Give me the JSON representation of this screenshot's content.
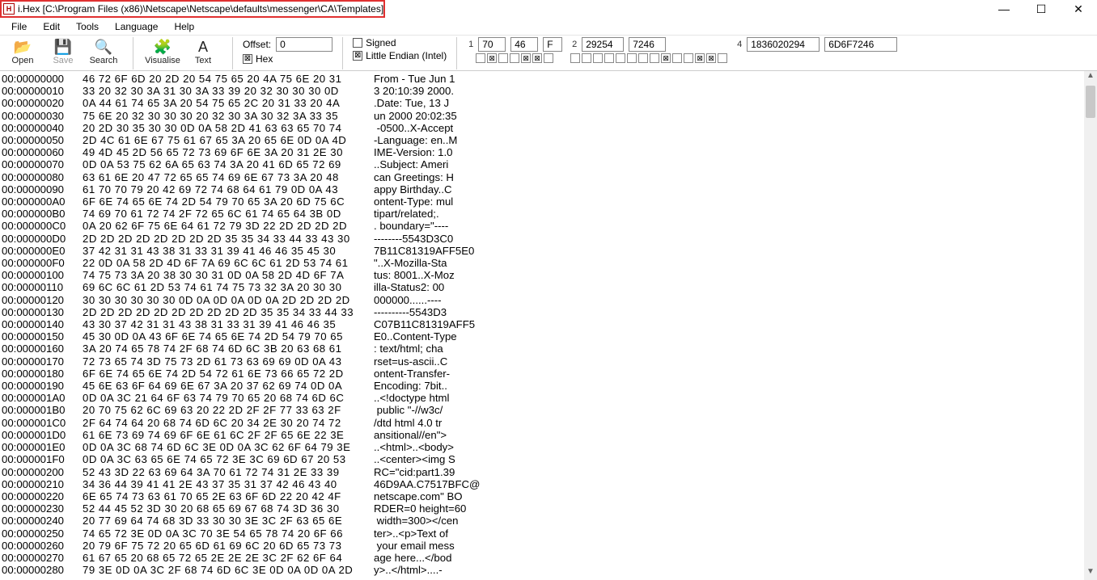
{
  "window": {
    "title": "i.Hex [C:\\Program Files (x86)\\Netscape\\Netscape\\defaults\\messenger\\CA\\Templates]"
  },
  "menu": {
    "items": [
      "File",
      "Edit",
      "Tools",
      "Language",
      "Help"
    ]
  },
  "toolbar": {
    "open": "Open",
    "save": "Save",
    "search": "Search",
    "visualise": "Visualise",
    "text": "Text"
  },
  "offset": {
    "label": "Offset:",
    "value": "0",
    "hex_label": "Hex",
    "hex_checked": true
  },
  "flags": {
    "signed": "Signed",
    "signed_checked": false,
    "endian": "Little Endian (Intel)",
    "endian_checked": true
  },
  "values": {
    "g1": {
      "idx": "1",
      "a": "70",
      "b": "46",
      "c": "F",
      "boxes": [
        "",
        "⊠",
        "",
        "",
        "⊠",
        "⊠",
        ""
      ]
    },
    "g2": {
      "idx": "2",
      "a": "29254",
      "b": "7246",
      "boxes": [
        "",
        "",
        "",
        "",
        "",
        "",
        "",
        "",
        "⊠",
        "",
        "",
        "⊠",
        "⊠",
        ""
      ]
    },
    "g4": {
      "idx": "4",
      "a": "1836020294",
      "b": "6D6F7246"
    }
  },
  "hex": {
    "lines": [
      {
        "addr": "00:00000000",
        "bytes": "46 72 6F 6D 20 2D 20 54 75 65 20 4A 75 6E 20 31",
        "ascii": "From - Tue Jun 1"
      },
      {
        "addr": "00:00000010",
        "bytes": "33 20 32 30 3A 31 30 3A 33 39 20 32 30 30 30 0D",
        "ascii": "3 20:10:39 2000."
      },
      {
        "addr": "00:00000020",
        "bytes": "0A 44 61 74 65 3A 20 54 75 65 2C 20 31 33 20 4A",
        "ascii": ".Date: Tue, 13 J"
      },
      {
        "addr": "00:00000030",
        "bytes": "75 6E 20 32 30 30 30 20 32 30 3A 30 32 3A 33 35",
        "ascii": "un 2000 20:02:35"
      },
      {
        "addr": "00:00000040",
        "bytes": "20 2D 30 35 30 30 0D 0A 58 2D 41 63 63 65 70 74",
        "ascii": " -0500..X-Accept"
      },
      {
        "addr": "00:00000050",
        "bytes": "2D 4C 61 6E 67 75 61 67 65 3A 20 65 6E 0D 0A 4D",
        "ascii": "-Language: en..M"
      },
      {
        "addr": "00:00000060",
        "bytes": "49 4D 45 2D 56 65 72 73 69 6F 6E 3A 20 31 2E 30",
        "ascii": "IME-Version: 1.0"
      },
      {
        "addr": "00:00000070",
        "bytes": "0D 0A 53 75 62 6A 65 63 74 3A 20 41 6D 65 72 69",
        "ascii": "..Subject: Ameri"
      },
      {
        "addr": "00:00000080",
        "bytes": "63 61 6E 20 47 72 65 65 74 69 6E 67 73 3A 20 48",
        "ascii": "can Greetings: H"
      },
      {
        "addr": "00:00000090",
        "bytes": "61 70 70 79 20 42 69 72 74 68 64 61 79 0D 0A 43",
        "ascii": "appy Birthday..C"
      },
      {
        "addr": "00:000000A0",
        "bytes": "6F 6E 74 65 6E 74 2D 54 79 70 65 3A 20 6D 75 6C",
        "ascii": "ontent-Type: mul"
      },
      {
        "addr": "00:000000B0",
        "bytes": "74 69 70 61 72 74 2F 72 65 6C 61 74 65 64 3B 0D",
        "ascii": "tipart/related;."
      },
      {
        "addr": "00:000000C0",
        "bytes": "0A 20 62 6F 75 6E 64 61 72 79 3D 22 2D 2D 2D 2D",
        "ascii": ". boundary=\"----"
      },
      {
        "addr": "00:000000D0",
        "bytes": "2D 2D 2D 2D 2D 2D 2D 2D 35 35 34 33 44 33 43 30",
        "ascii": "--------5543D3C0"
      },
      {
        "addr": "00:000000E0",
        "bytes": "37 42 31 31 43 38 31 33 31 39 41 46 46 35 45 30",
        "ascii": "7B11C81319AFF5E0"
      },
      {
        "addr": "00:000000F0",
        "bytes": "22 0D 0A 58 2D 4D 6F 7A 69 6C 6C 61 2D 53 74 61",
        "ascii": "\"..X-Mozilla-Sta"
      },
      {
        "addr": "00:00000100",
        "bytes": "74 75 73 3A 20 38 30 30 31 0D 0A 58 2D 4D 6F 7A",
        "ascii": "tus: 8001..X-Moz"
      },
      {
        "addr": "00:00000110",
        "bytes": "69 6C 6C 61 2D 53 74 61 74 75 73 32 3A 20 30 30",
        "ascii": "illa-Status2: 00"
      },
      {
        "addr": "00:00000120",
        "bytes": "30 30 30 30 30 30 0D 0A 0D 0A 0D 0A 2D 2D 2D 2D",
        "ascii": "000000......----"
      },
      {
        "addr": "00:00000130",
        "bytes": "2D 2D 2D 2D 2D 2D 2D 2D 2D 2D 35 35 34 33 44 33",
        "ascii": "----------5543D3"
      },
      {
        "addr": "00:00000140",
        "bytes": "43 30 37 42 31 31 43 38 31 33 31 39 41 46 46 35",
        "ascii": "C07B11C81319AFF5"
      },
      {
        "addr": "00:00000150",
        "bytes": "45 30 0D 0A 43 6F 6E 74 65 6E 74 2D 54 79 70 65",
        "ascii": "E0..Content-Type"
      },
      {
        "addr": "00:00000160",
        "bytes": "3A 20 74 65 78 74 2F 68 74 6D 6C 3B 20 63 68 61",
        "ascii": ": text/html; cha"
      },
      {
        "addr": "00:00000170",
        "bytes": "72 73 65 74 3D 75 73 2D 61 73 63 69 69 0D 0A 43",
        "ascii": "rset=us-ascii..C"
      },
      {
        "addr": "00:00000180",
        "bytes": "6F 6E 74 65 6E 74 2D 54 72 61 6E 73 66 65 72 2D",
        "ascii": "ontent-Transfer-"
      },
      {
        "addr": "00:00000190",
        "bytes": "45 6E 63 6F 64 69 6E 67 3A 20 37 62 69 74 0D 0A",
        "ascii": "Encoding: 7bit.."
      },
      {
        "addr": "00:000001A0",
        "bytes": "0D 0A 3C 21 64 6F 63 74 79 70 65 20 68 74 6D 6C",
        "ascii": "..<!doctype html"
      },
      {
        "addr": "00:000001B0",
        "bytes": "20 70 75 62 6C 69 63 20 22 2D 2F 2F 77 33 63 2F",
        "ascii": " public \"-//w3c/"
      },
      {
        "addr": "00:000001C0",
        "bytes": "2F 64 74 64 20 68 74 6D 6C 20 34 2E 30 20 74 72",
        "ascii": "/dtd html 4.0 tr"
      },
      {
        "addr": "00:000001D0",
        "bytes": "61 6E 73 69 74 69 6F 6E 61 6C 2F 2F 65 6E 22 3E",
        "ascii": "ansitional//en\">"
      },
      {
        "addr": "00:000001E0",
        "bytes": "0D 0A 3C 68 74 6D 6C 3E 0D 0A 3C 62 6F 64 79 3E",
        "ascii": "..<html>..<body>"
      },
      {
        "addr": "00:000001F0",
        "bytes": "0D 0A 3C 63 65 6E 74 65 72 3E 3C 69 6D 67 20 53",
        "ascii": "..<center><img S"
      },
      {
        "addr": "00:00000200",
        "bytes": "52 43 3D 22 63 69 64 3A 70 61 72 74 31 2E 33 39",
        "ascii": "RC=\"cid:part1.39"
      },
      {
        "addr": "00:00000210",
        "bytes": "34 36 44 39 41 41 2E 43 37 35 31 37 42 46 43 40",
        "ascii": "46D9AA.C7517BFC@"
      },
      {
        "addr": "00:00000220",
        "bytes": "6E 65 74 73 63 61 70 65 2E 63 6F 6D 22 20 42 4F",
        "ascii": "netscape.com\" BO"
      },
      {
        "addr": "00:00000230",
        "bytes": "52 44 45 52 3D 30 20 68 65 69 67 68 74 3D 36 30",
        "ascii": "RDER=0 height=60"
      },
      {
        "addr": "00:00000240",
        "bytes": "20 77 69 64 74 68 3D 33 30 30 3E 3C 2F 63 65 6E",
        "ascii": " width=300></cen"
      },
      {
        "addr": "00:00000250",
        "bytes": "74 65 72 3E 0D 0A 3C 70 3E 54 65 78 74 20 6F 66",
        "ascii": "ter>..<p>Text of"
      },
      {
        "addr": "00:00000260",
        "bytes": "20 79 6F 75 72 20 65 6D 61 69 6C 20 6D 65 73 73",
        "ascii": " your email mess"
      },
      {
        "addr": "00:00000270",
        "bytes": "61 67 65 20 68 65 72 65 2E 2E 2E 3C 2F 62 6F 64",
        "ascii": "age here...</bod"
      },
      {
        "addr": "00:00000280",
        "bytes": "79 3E 0D 0A 3C 2F 68 74 6D 6C 3E 0D 0A 0D 0A 2D",
        "ascii": "y>..</html>....-"
      }
    ]
  }
}
